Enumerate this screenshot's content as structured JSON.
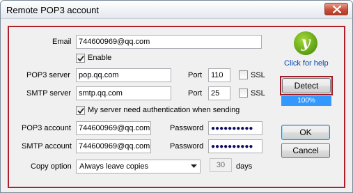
{
  "window": {
    "title": "Remote POP3 account"
  },
  "form": {
    "email_label": "Email",
    "email_value": "744600969@qq.com",
    "enable_label": "Enable",
    "enable_checked": true,
    "pop3_server_label": "POP3 server",
    "pop3_server_value": "pop.qq.com",
    "pop3_port_label": "Port",
    "pop3_port_value": "110",
    "pop3_ssl_label": "SSL",
    "pop3_ssl_checked": false,
    "smtp_server_label": "SMTP server",
    "smtp_server_value": "smtp.qq.com",
    "smtp_port_label": "Port",
    "smtp_port_value": "25",
    "smtp_ssl_label": "SSL",
    "smtp_ssl_checked": false,
    "auth_label": "My server need authentication when sending",
    "auth_checked": true,
    "pop3_account_label": "POP3 account",
    "pop3_account_value": "744600969@qq.com",
    "pop3_password_label": "Password",
    "pop3_password_value": "●●●●●●●●●●",
    "smtp_account_label": "SMTP account",
    "smtp_account_value": "744600969@qq.com",
    "smtp_password_label": "Password",
    "smtp_password_value": "●●●●●●●●●●",
    "copy_option_label": "Copy option",
    "copy_option_value": "Always leave copies",
    "days_value": "30",
    "days_label": "days"
  },
  "side": {
    "logo_glyph": "y",
    "help_label": "Click for help",
    "detect_label": "Detect",
    "progress_text": "100%",
    "progress_value": 1.0,
    "ok_label": "OK",
    "cancel_label": "Cancel"
  },
  "colors": {
    "highlight_frame": "#b0202a",
    "progress": "#3399ff",
    "link": "#0645ad"
  }
}
